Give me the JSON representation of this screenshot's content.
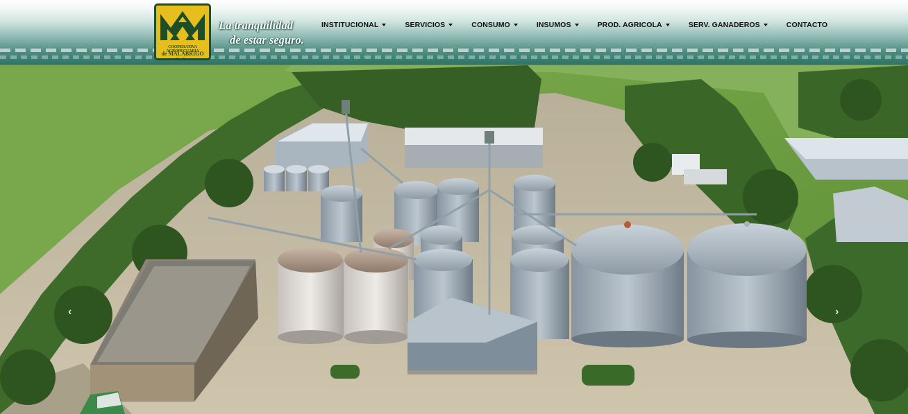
{
  "brand": {
    "logo_line1": "COOPERATIVA AGROPECUARIA",
    "logo_line2": "de MALABRIGO Ltda.",
    "logo_colors": {
      "background": "#e6bf1e",
      "foreground": "#1d4e2a"
    }
  },
  "tagline": {
    "line1": "La tranquilidad",
    "line2": "de estar seguro."
  },
  "nav": {
    "items": [
      {
        "label": "INSTITUCIONAL",
        "dropdown": true
      },
      {
        "label": "SERVICIOS",
        "dropdown": true
      },
      {
        "label": "CONSUMO",
        "dropdown": true
      },
      {
        "label": "INSUMOS",
        "dropdown": true
      },
      {
        "label": "PROD. AGRICOLA",
        "dropdown": true
      },
      {
        "label": "SERV. GANADEROS",
        "dropdown": true
      },
      {
        "label": "CONTACTO",
        "dropdown": false
      }
    ]
  },
  "slider": {
    "prev_glyph": "‹",
    "next_glyph": "›",
    "image_subject": "grain-silo-facility-aerial"
  },
  "colors": {
    "header_top": "#ffffff",
    "header_bottom": "#2f7568",
    "nav_text": "#111111"
  }
}
